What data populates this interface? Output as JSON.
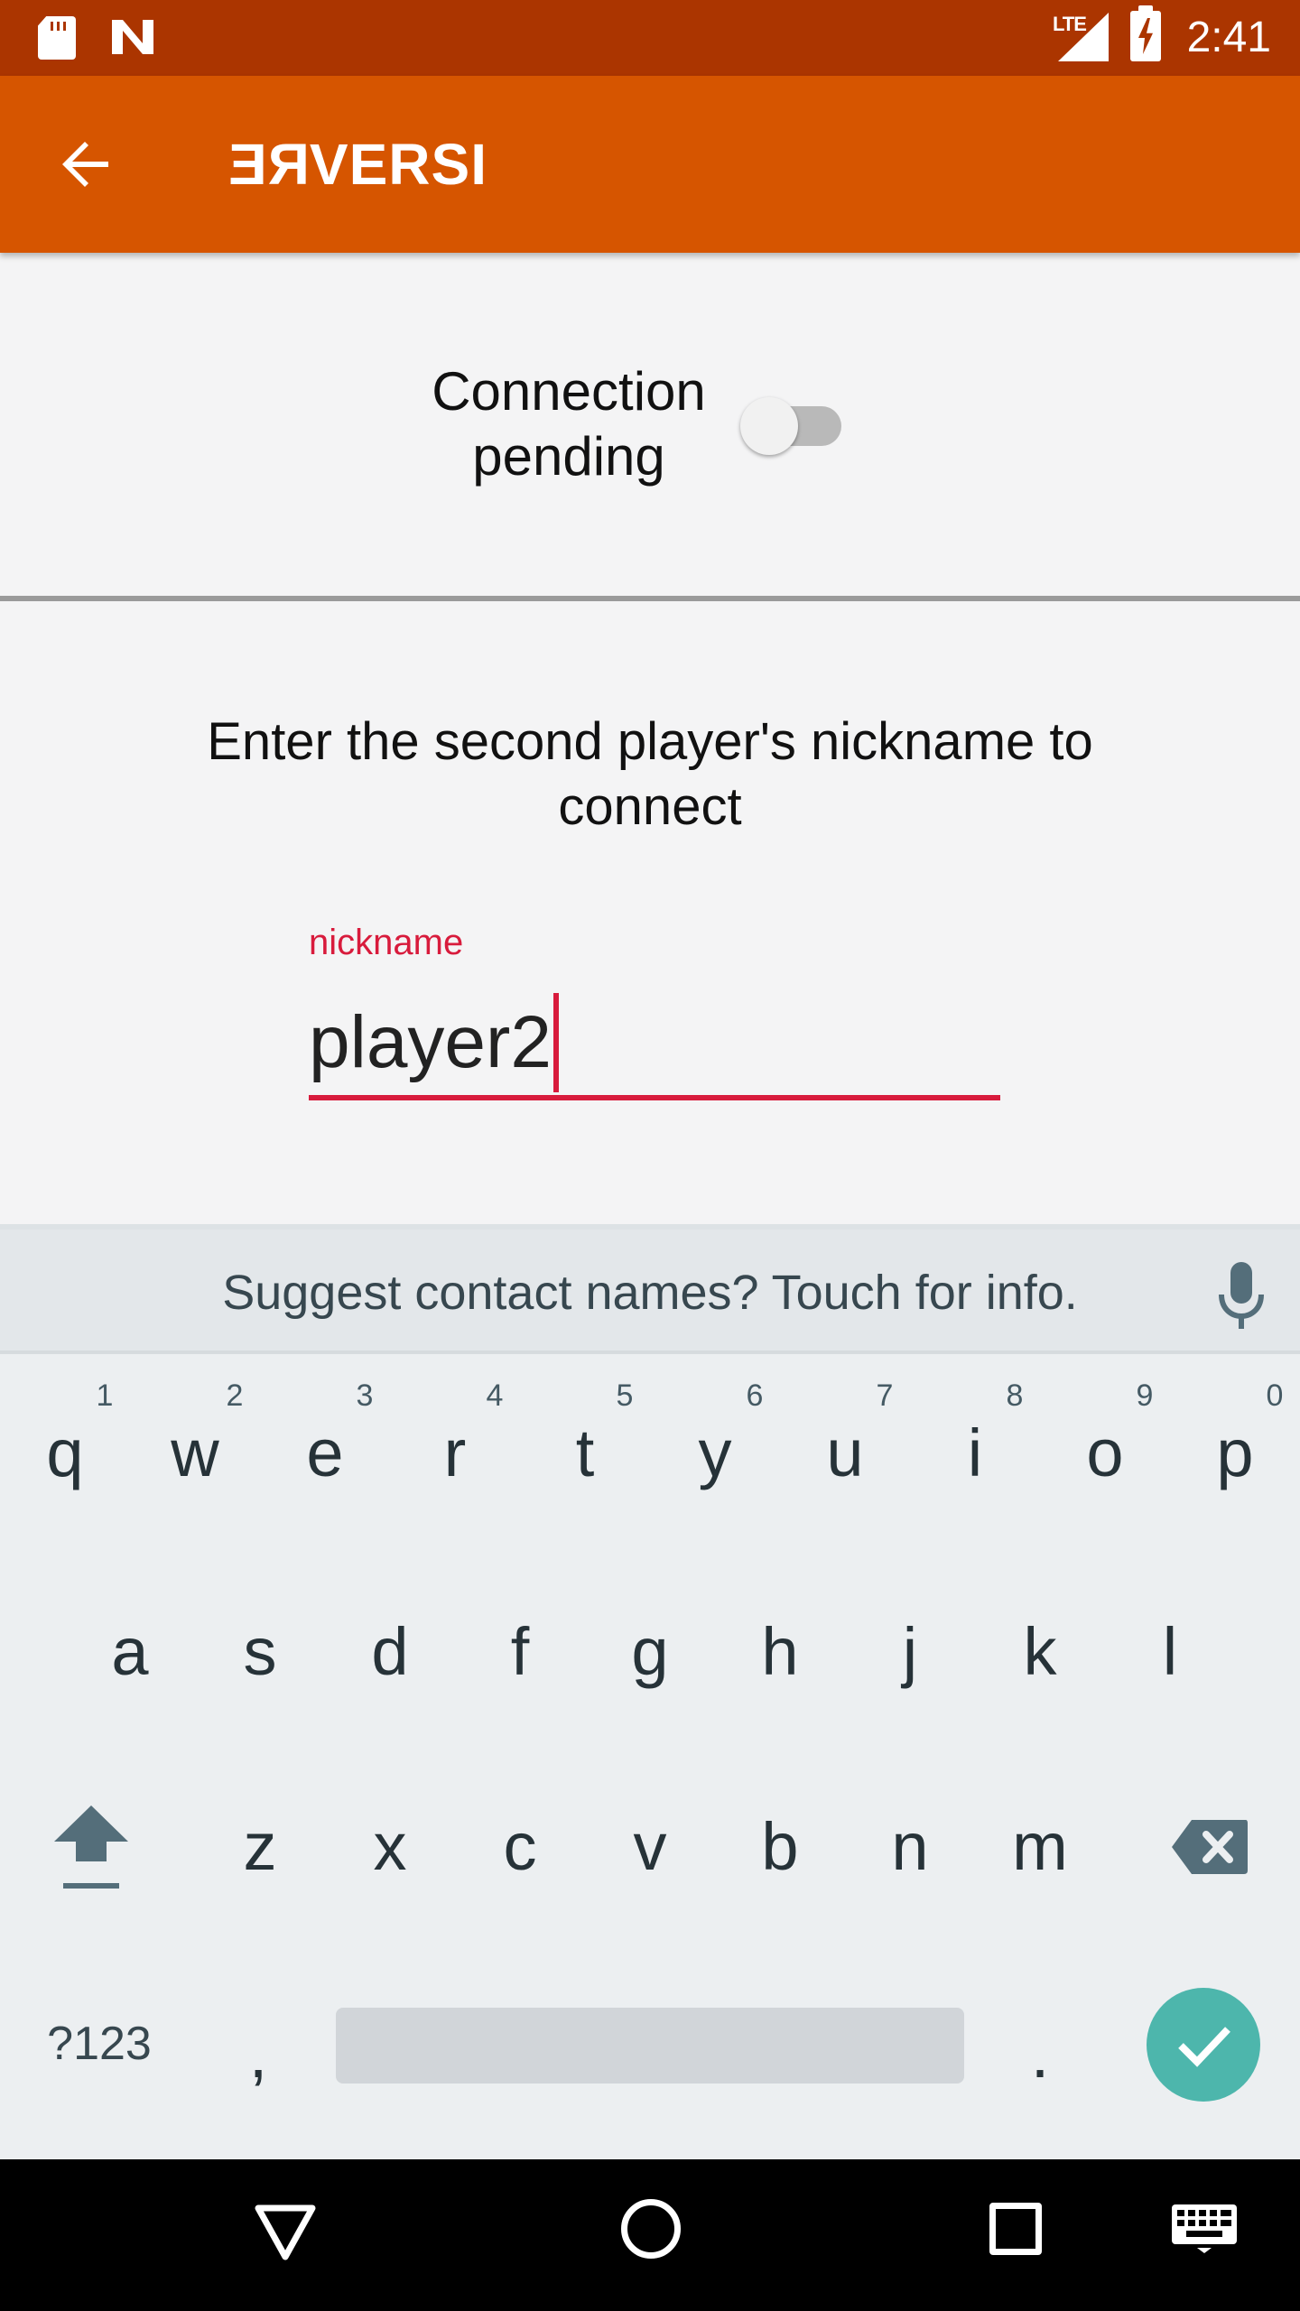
{
  "status_bar": {
    "network_label": "LTE",
    "time": "2:41",
    "icons": [
      "sd-card-icon",
      "n-notification-icon",
      "lte-signal-icon",
      "battery-charging-icon"
    ]
  },
  "app_bar": {
    "title_mirrored_part": "RE",
    "title_rest": "VERSI",
    "back_icon": "arrow-back-icon"
  },
  "connection": {
    "label": "Connection pending",
    "toggle_on": false
  },
  "nickname": {
    "prompt": "Enter the second player's nickname to connect",
    "field_label": "nickname",
    "value": "player2"
  },
  "keyboard": {
    "suggestion": "Suggest contact names? Touch for info.",
    "row1": [
      {
        "key": "q",
        "hint": "1"
      },
      {
        "key": "w",
        "hint": "2"
      },
      {
        "key": "e",
        "hint": "3"
      },
      {
        "key": "r",
        "hint": "4"
      },
      {
        "key": "t",
        "hint": "5"
      },
      {
        "key": "y",
        "hint": "6"
      },
      {
        "key": "u",
        "hint": "7"
      },
      {
        "key": "i",
        "hint": "8"
      },
      {
        "key": "o",
        "hint": "9"
      },
      {
        "key": "p",
        "hint": "0"
      }
    ],
    "row2": [
      "a",
      "s",
      "d",
      "f",
      "g",
      "h",
      "j",
      "k",
      "l"
    ],
    "row3": [
      "z",
      "x",
      "c",
      "v",
      "b",
      "n",
      "m"
    ],
    "symbols_label": "?123",
    "comma": ",",
    "period": ".",
    "colors": {
      "accent": "#4db6ac",
      "background": "#eceff1"
    }
  },
  "colors": {
    "status_bar": "#ab3500",
    "app_bar": "#d65500",
    "field_accent": "#d81b3c"
  }
}
